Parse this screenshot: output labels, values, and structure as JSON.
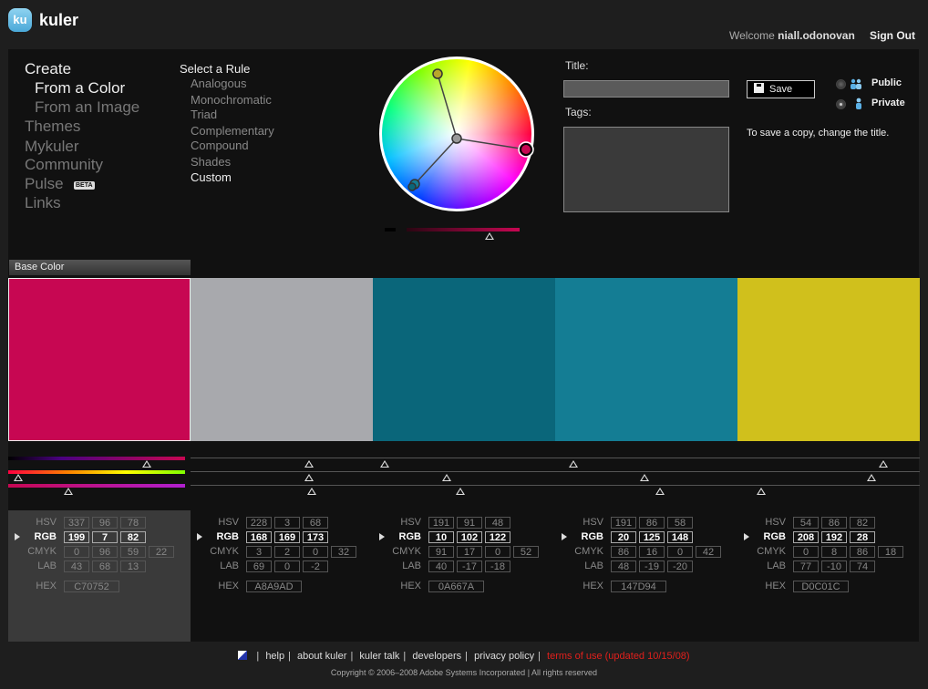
{
  "app": {
    "logo_badge": "ku",
    "logo_text": "kuler"
  },
  "header": {
    "welcome_prefix": "Welcome",
    "username": "niall.odonovan",
    "signout": "Sign Out"
  },
  "nav": {
    "create": "Create",
    "from_color": "From a Color",
    "from_image": "From an Image",
    "themes": "Themes",
    "mykuler": "Mykuler",
    "community": "Community",
    "pulse": "Pulse",
    "beta": "BETA",
    "links": "Links"
  },
  "rules": {
    "title": "Select a Rule",
    "items": [
      "Analogous",
      "Monochromatic",
      "Triad",
      "Complementary",
      "Compound",
      "Shades",
      "Custom"
    ],
    "selected": "Custom"
  },
  "form": {
    "title_label": "Title:",
    "title_value": "",
    "tags_label": "Tags:",
    "save_label": "Save",
    "public_label": "Public",
    "private_label": "Private",
    "visibility": "Private",
    "note": "To save a copy, change the title."
  },
  "base_color_tab": "Base Color",
  "swatches": [
    {
      "color": "#C70752",
      "hsv": [
        "337",
        "96",
        "78"
      ],
      "rgb": [
        "199",
        "7",
        "82"
      ],
      "cmyk": [
        "0",
        "96",
        "59",
        "22"
      ],
      "lab": [
        "43",
        "68",
        "13"
      ],
      "hex": "C70752"
    },
    {
      "color": "#A8A9AD",
      "hsv": [
        "228",
        "3",
        "68"
      ],
      "rgb": [
        "168",
        "169",
        "173"
      ],
      "cmyk": [
        "3",
        "2",
        "0",
        "32"
      ],
      "lab": [
        "69",
        "0",
        "-2"
      ],
      "hex": "A8A9AD"
    },
    {
      "color": "#0A667A",
      "hsv": [
        "191",
        "91",
        "48"
      ],
      "rgb": [
        "10",
        "102",
        "122"
      ],
      "cmyk": [
        "91",
        "17",
        "0",
        "52"
      ],
      "lab": [
        "40",
        "-17",
        "-18"
      ],
      "hex": "0A667A"
    },
    {
      "color": "#147D94",
      "hsv": [
        "191",
        "86",
        "58"
      ],
      "rgb": [
        "20",
        "125",
        "148"
      ],
      "cmyk": [
        "86",
        "16",
        "0",
        "42"
      ],
      "lab": [
        "48",
        "-19",
        "-20"
      ],
      "hex": "147D94"
    },
    {
      "color": "#D0C01C",
      "hsv": [
        "54",
        "86",
        "82"
      ],
      "rgb": [
        "208",
        "192",
        "28"
      ],
      "cmyk": [
        "0",
        "8",
        "86",
        "18"
      ],
      "lab": [
        "77",
        "-10",
        "74"
      ],
      "hex": "D0C01C"
    }
  ],
  "labels": {
    "hsv": "HSV",
    "rgb": "RGB",
    "cmyk": "CMYK",
    "lab": "LAB",
    "hex": "HEX"
  },
  "footer": {
    "links": [
      "help",
      "about kuler",
      "kuler talk",
      "developers",
      "privacy policy"
    ],
    "terms": "terms of use (updated 10/15/08)",
    "copyright": "Copyright © 2006–2008 Adobe Systems Incorporated | All rights reserved"
  },
  "colors": {
    "background": "#1e1e1e",
    "panel": "#111111",
    "accent_red": "#e0201c"
  }
}
